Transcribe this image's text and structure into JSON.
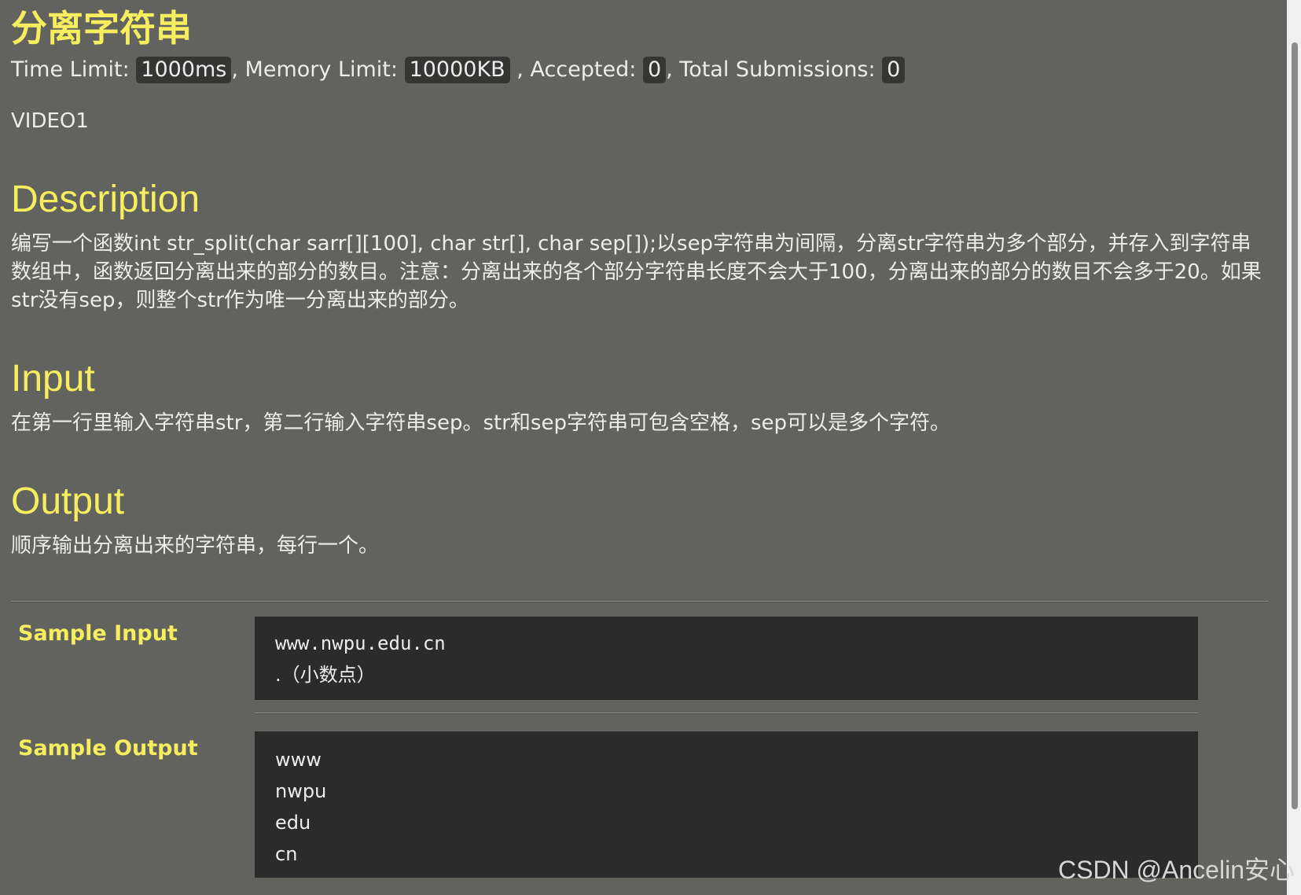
{
  "problem": {
    "title": "分离字符串",
    "limits": {
      "time_label": "Time Limit:",
      "time_value": "1000ms",
      "memory_label": ", Memory Limit:",
      "memory_value": "10000KB",
      "accepted_label": ", Accepted:",
      "accepted_value": "0",
      "submissions_label": ", Total Submissions:",
      "submissions_value": "0"
    },
    "video_label": "VIDEO1"
  },
  "description": {
    "heading": "Description",
    "text": "编写一个函数int str_split(char sarr[][100], char str[], char sep[]);以sep字符串为间隔，分离str字符串为多个部分，并存入到字符串数组中，函数返回分离出来的部分的数目。注意：分离出来的各个部分字符串长度不会大于100，分离出来的部分的数目不会多于20。如果str没有sep，则整个str作为唯一分离出来的部分。"
  },
  "input": {
    "heading": "Input",
    "text": "在第一行里输入字符串str，第二行输入字符串sep。str和sep字符串可包含空格，sep可以是多个字符。"
  },
  "output": {
    "heading": "Output",
    "text": "顺序输出分离出来的字符串，每行一个。"
  },
  "sample_input": {
    "label": "Sample Input",
    "lines": [
      "www.nwpu.edu.cn",
      ".（小数点）"
    ]
  },
  "sample_output": {
    "label": "Sample Output",
    "lines": [
      "www",
      "nwpu",
      "edu",
      "cn"
    ]
  },
  "watermark": "CSDN @Ancelin安心",
  "colors": {
    "background": "#62635e",
    "heading": "#f6ee5f",
    "code_background": "#2b2b2b",
    "badge_background": "#353633"
  }
}
